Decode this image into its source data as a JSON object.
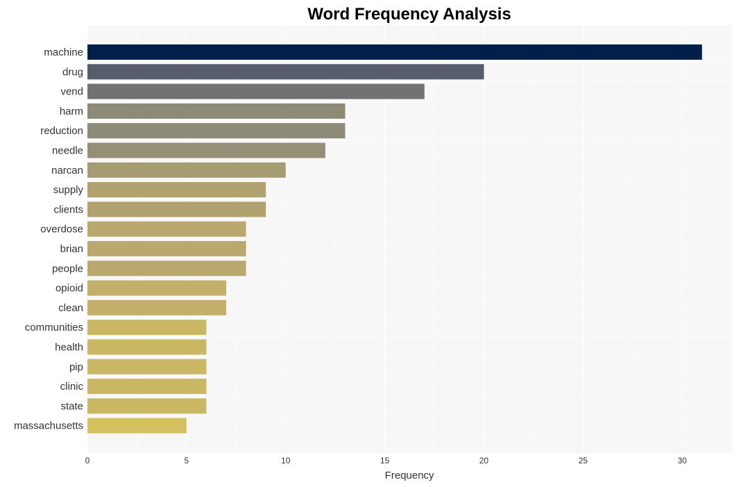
{
  "chart_data": {
    "type": "bar",
    "orientation": "horizontal",
    "title": "Word Frequency Analysis",
    "xlabel": "Frequency",
    "ylabel": "",
    "categories": [
      "machine",
      "drug",
      "vend",
      "harm",
      "reduction",
      "needle",
      "narcan",
      "supply",
      "clients",
      "overdose",
      "brian",
      "people",
      "opioid",
      "clean",
      "communities",
      "health",
      "pip",
      "clinic",
      "state",
      "massachusetts"
    ],
    "values": [
      31,
      20,
      17,
      13,
      13,
      12,
      10,
      9,
      9,
      8,
      8,
      8,
      7,
      7,
      6,
      6,
      6,
      6,
      6,
      5
    ],
    "colors": [
      "#00204c",
      "#575d6d",
      "#727272",
      "#8d8a78",
      "#8d8a78",
      "#958f78",
      "#a59c74",
      "#b0a26f",
      "#b0a26f",
      "#b9a96e",
      "#b9a96e",
      "#b9a96e",
      "#c2af6a",
      "#c2af6a",
      "#cab764",
      "#cab764",
      "#cab764",
      "#cab764",
      "#cab764",
      "#d3c15f"
    ],
    "xticks": [
      0,
      5,
      10,
      15,
      20,
      25,
      30
    ],
    "xlim": [
      0,
      32.55
    ],
    "grid": true,
    "legend": "none",
    "background": "#f7f7f7"
  }
}
